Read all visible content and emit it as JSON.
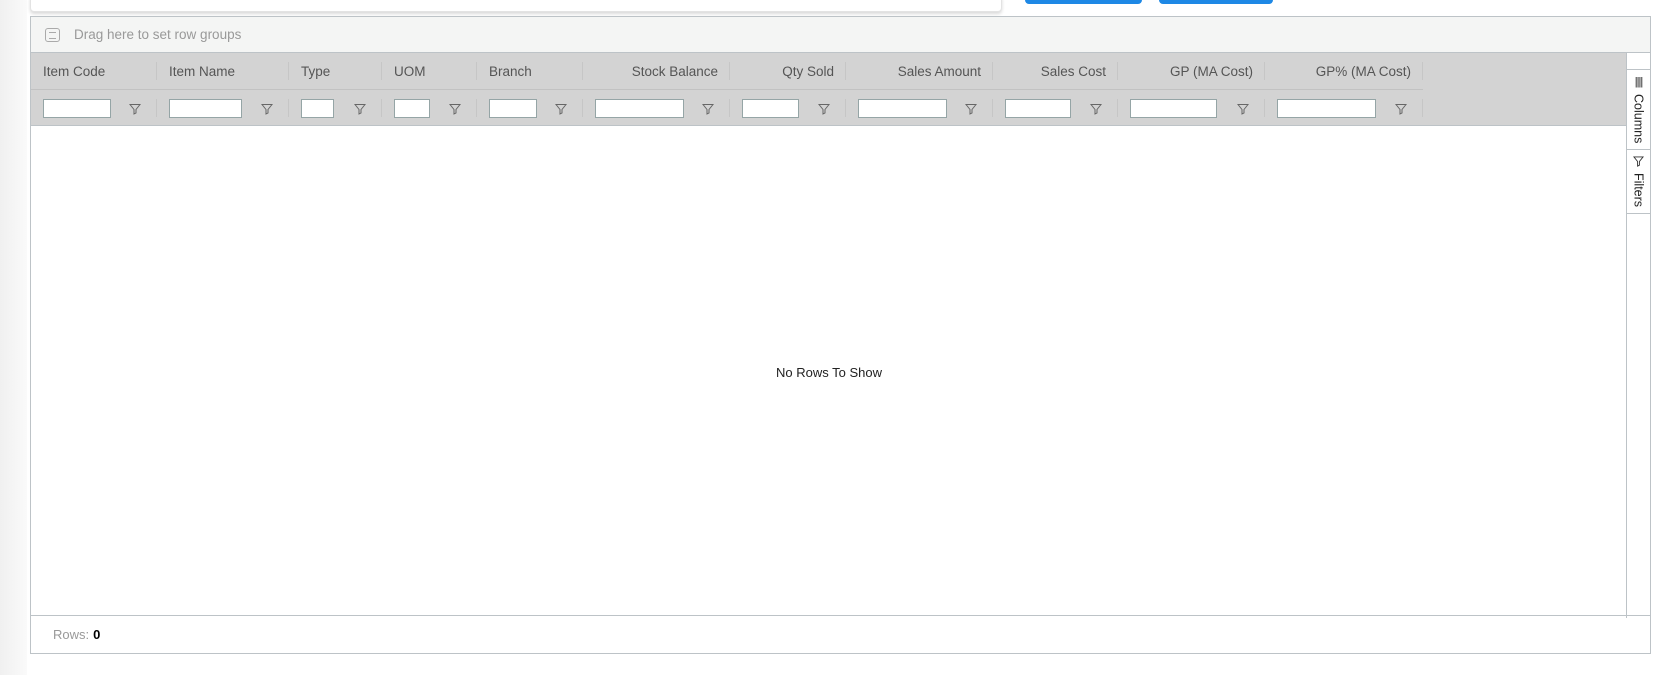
{
  "grid": {
    "group_panel_text": "Drag here to set row groups",
    "columns": [
      {
        "label": "Item Code",
        "align": "left"
      },
      {
        "label": "Item Name",
        "align": "left"
      },
      {
        "label": "Type",
        "align": "left"
      },
      {
        "label": "UOM",
        "align": "left"
      },
      {
        "label": "Branch",
        "align": "left"
      },
      {
        "label": "Stock Balance",
        "align": "right"
      },
      {
        "label": "Qty Sold",
        "align": "right"
      },
      {
        "label": "Sales Amount",
        "align": "right"
      },
      {
        "label": "Sales Cost",
        "align": "right"
      },
      {
        "label": "GP (MA Cost)",
        "align": "right"
      },
      {
        "label": "GP% (MA Cost)",
        "align": "right"
      }
    ],
    "filter_values": [
      "",
      "",
      "",
      "",
      "",
      "",
      "",
      "",
      "",
      "",
      ""
    ],
    "empty_text": "No Rows To Show",
    "side_bar": {
      "columns_label": "Columns",
      "filters_label": "Filters"
    },
    "footer": {
      "rows_label": "Rows:",
      "rows_value": "0"
    }
  },
  "colors": {
    "accent": "#1e88e5",
    "header_bg": "#d3d3d3",
    "group_bg": "#f4f5f4"
  }
}
